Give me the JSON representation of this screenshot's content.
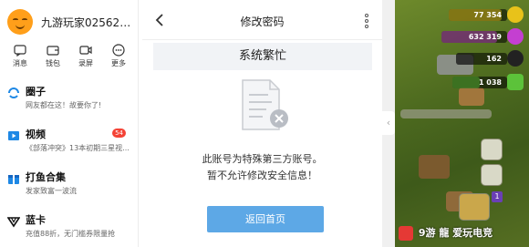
{
  "sidebar": {
    "username": "九游玩家025627...",
    "quick_actions": [
      {
        "label": "消息",
        "icon": "message-icon"
      },
      {
        "label": "钱包",
        "icon": "wallet-icon"
      },
      {
        "label": "录屏",
        "icon": "record-icon"
      },
      {
        "label": "更多",
        "icon": "more-icon"
      }
    ],
    "features": [
      {
        "title": "圈子",
        "subtitle": "网友都在这！故要你了!",
        "icon": "circle-icon",
        "badge": ""
      },
      {
        "title": "视频",
        "subtitle": "《部落冲突》13本初期三星视...",
        "icon": "video-icon",
        "badge": "54"
      },
      {
        "title": "打鱼合集",
        "subtitle": "发家致富一波流",
        "icon": "gift-icon",
        "badge": ""
      },
      {
        "title": "蓝卡",
        "subtitle": "充值88折，无门槛券限量抢",
        "icon": "card-icon",
        "badge": ""
      }
    ]
  },
  "dialog": {
    "title": "修改密码",
    "status_bar": "系统繁忙",
    "message_line1": "此账号为特殊第三方账号。",
    "message_line2": "暂不允许修改安全信息！",
    "home_button": "返回首页"
  },
  "game": {
    "resources": [
      {
        "value": "77 354",
        "color": "#e8c21a",
        "fill": 0.9
      },
      {
        "value": "632 319",
        "color": "#c43fd1",
        "fill": 0.85
      },
      {
        "value": "162",
        "color": "#222222",
        "fill": 0.35
      },
      {
        "value": "1 038",
        "color": "#5cc23a",
        "fill": 0.5
      }
    ],
    "shield_badge": "1",
    "watermark": "9游 龍 爱玩电竞"
  }
}
